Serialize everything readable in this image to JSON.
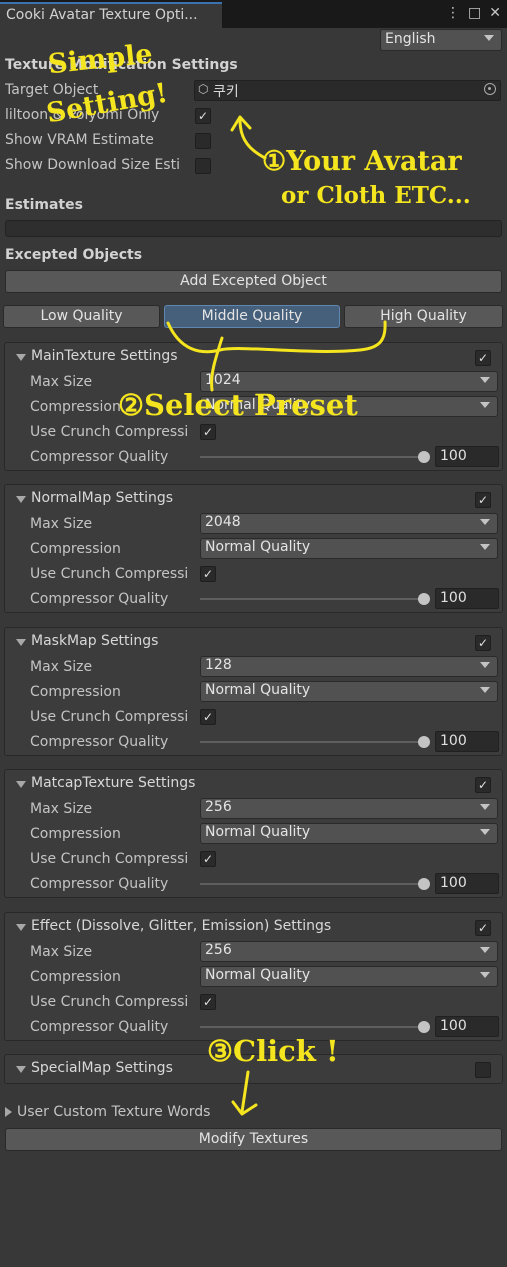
{
  "window": {
    "tab_title": "Cooki Avatar Texture Opti...",
    "icons": [
      "more-icon",
      "maximize-icon",
      "close-icon"
    ]
  },
  "language": {
    "selected": "English"
  },
  "texture_mod": {
    "header": "Texture Modification Settings",
    "target_label": "Target Object",
    "target_value": "쿠키",
    "liltoon_label": "liltoon & Poiyomi Only",
    "liltoon_checked": true,
    "vram_label": "Show VRAM Estimate",
    "vram_checked": false,
    "download_label": "Show Download Size Esti",
    "download_checked": false
  },
  "estimates": {
    "header": "Estimates"
  },
  "excepted": {
    "header": "Excepted Objects",
    "add_button": "Add Excepted Object"
  },
  "quality_buttons": [
    "Low Quality",
    "Middle Quality",
    "High Quality"
  ],
  "quality_selected": "Middle Quality",
  "field_labels": {
    "max_size": "Max Size",
    "compression": "Compression",
    "crunch": "Use Crunch Compressi",
    "compressor_quality": "Compressor Quality"
  },
  "sections": [
    {
      "title": "MainTexture Settings",
      "enabled": true,
      "max_size": "1024",
      "compression": "Normal Quality",
      "crunch": true,
      "quality": "100"
    },
    {
      "title": "NormalMap Settings",
      "enabled": true,
      "max_size": "2048",
      "compression": "Normal Quality",
      "crunch": true,
      "quality": "100"
    },
    {
      "title": "MaskMap Settings",
      "enabled": true,
      "max_size": "128",
      "compression": "Normal Quality",
      "crunch": true,
      "quality": "100"
    },
    {
      "title": "MatcapTexture Settings",
      "enabled": true,
      "max_size": "256",
      "compression": "Normal Quality",
      "crunch": true,
      "quality": "100"
    },
    {
      "title": "Effect (Dissolve, Glitter, Emission) Settings",
      "enabled": true,
      "max_size": "256",
      "compression": "Normal Quality",
      "crunch": true,
      "quality": "100"
    }
  ],
  "special_map": {
    "title": "SpecialMap Settings",
    "enabled": false
  },
  "custom_words": {
    "label": "User Custom Texture Words"
  },
  "modify_button": "Modify Textures",
  "annotations": {
    "simple": "Simple",
    "setting": "Setting!",
    "step1_line1": "①Your Avatar",
    "step1_line2": "or Cloth ETC...",
    "step2": "②Select Preset",
    "step3": "③Click !"
  },
  "colors": {
    "background": "#383838",
    "selected_button": "#46607c",
    "annotation": "#f5e51e"
  }
}
